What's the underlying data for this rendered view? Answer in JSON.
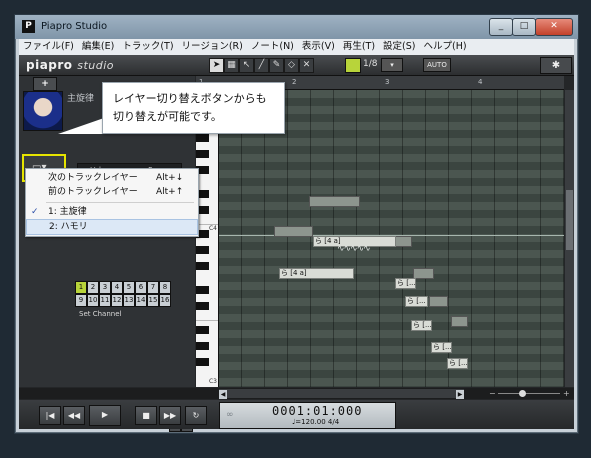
{
  "window": {
    "title": "Piapro Studio",
    "minimize": "_",
    "maximize": "□",
    "close": "✕"
  },
  "menubar": [
    "ファイル(F)",
    "編集(E)",
    "トラック(T)",
    "リージョン(R)",
    "ノート(N)",
    "表示(V)",
    "再生(T)",
    "設定(S)",
    "ヘルプ(H)"
  ],
  "toolbar": {
    "logo_main": "piapro",
    "logo_sub": "studio",
    "quantize": "1/8",
    "auto_label": "AUTO"
  },
  "track": {
    "add": "+",
    "name": "主旋律",
    "volume_label": "Volume",
    "pan_label": "Pan",
    "solo_label": "Set Channel",
    "channels": [
      "1",
      "2",
      "3",
      "4",
      "5",
      "6",
      "7",
      "8",
      "9",
      "10",
      "11",
      "12",
      "13",
      "14",
      "15",
      "16"
    ]
  },
  "layer_menu": {
    "next_label": "次のトラックレイヤー",
    "next_shortcut": "Alt+↓",
    "prev_label": "前のトラックレイヤー",
    "prev_shortcut": "Alt+↑",
    "layers": [
      {
        "label": "1: 主旋律",
        "checked": true
      },
      {
        "label": "2: ハモリ",
        "checked": false
      }
    ]
  },
  "callout": {
    "line1": "レイヤー切り替えボタンからも",
    "line2": "切り替えが可能です。"
  },
  "ruler": [
    "1",
    "2",
    "3",
    "4"
  ],
  "keys": {
    "c4": "C4",
    "c3": "C3"
  },
  "notes": [
    {
      "text": "ら [4 a]",
      "dim": false
    },
    {
      "text": "ら [4 a]",
      "dim": false
    },
    {
      "text": "ら [...",
      "dim": false
    },
    {
      "text": "ら [...",
      "dim": false
    },
    {
      "text": "ら [...",
      "dim": false
    },
    {
      "text": "ら [...",
      "dim": false
    },
    {
      "text": "ら [...",
      "dim": false
    }
  ],
  "vibrato": "∿∿∿∿∿",
  "transport": {
    "time": "0001:01:000",
    "tempo": "♩=120.00  4/4"
  }
}
